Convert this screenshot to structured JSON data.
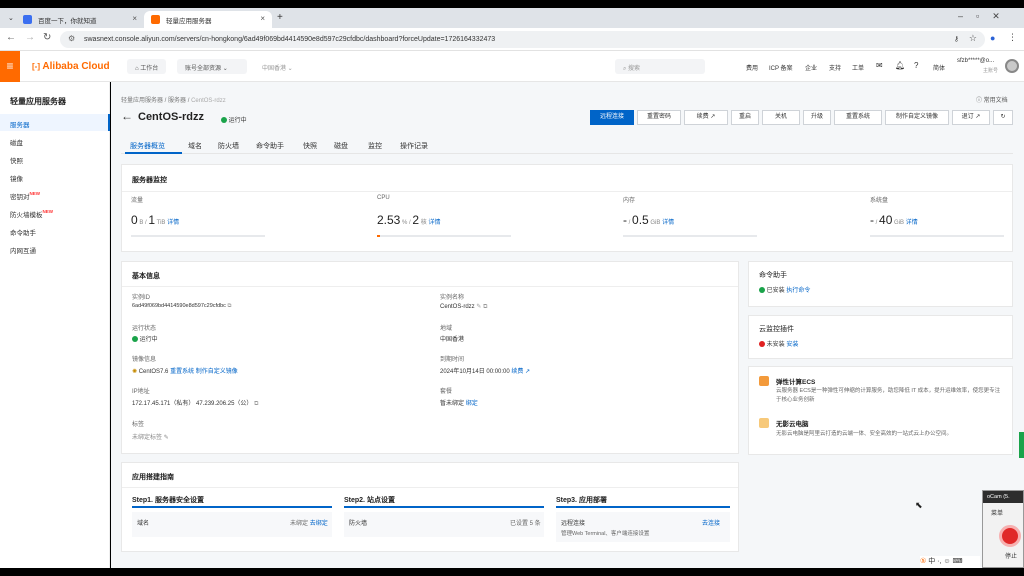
{
  "browser": {
    "tabs": [
      {
        "label": "百度一下，你就知道"
      },
      {
        "label": "轻量应用服务器"
      }
    ],
    "url": "swasnext.console.aliyun.com/servers/cn-hongkong/6ad49f069bd4414590e8d597c29cfdbc/dashboard?forceUpdate=1726164332473"
  },
  "header": {
    "brand": "Alibaba Cloud",
    "workbench": "工作台",
    "resources": "账号全部资源",
    "region": "中国香港",
    "search_placeholder": "搜索",
    "links": [
      "费用",
      "ICP 备案",
      "企业",
      "支持",
      "工单"
    ],
    "lang": "简体",
    "account": "sfzb*****@o...",
    "account_role": "主账号"
  },
  "sidebar": {
    "title": "轻量应用服务器",
    "items": [
      {
        "label": "服务器"
      },
      {
        "label": "磁盘"
      },
      {
        "label": "快照"
      },
      {
        "label": "镜像"
      },
      {
        "label": "密钥对",
        "badge": "NEW"
      },
      {
        "label": "防火墙模板",
        "badge": "NEW"
      },
      {
        "label": "命令助手"
      },
      {
        "label": "内网互通"
      }
    ]
  },
  "breadcrumb": [
    "轻量应用服务器",
    "服务器",
    "CentOS-rdzz"
  ],
  "help_doc": "常用文档",
  "server": {
    "name": "CentOS-rdzz",
    "status": "运行中"
  },
  "actions": [
    "远程连接",
    "重置密码",
    "续费",
    "重启",
    "关机",
    "升级",
    "重置系统",
    "制作自定义镜像",
    "退订"
  ],
  "page_tabs": [
    "服务器概览",
    "域名",
    "防火墙",
    "命令助手",
    "快照",
    "磁盘",
    "监控",
    "操作记录"
  ],
  "monitor": {
    "title": "服务器监控",
    "metrics": [
      {
        "label": "流量",
        "used": "0",
        "unit_used": "B",
        "total": "1",
        "unit_total": "TiB",
        "detail": "详情",
        "fraction": 0
      },
      {
        "label": "CPU",
        "used": "2.53",
        "unit_used": "%",
        "total": "2",
        "unit_total": "核",
        "detail": "详情",
        "fraction": 0.0253
      },
      {
        "label": "内存",
        "used": "-",
        "unit_used": "",
        "total": "0.5",
        "unit_total": "GiB",
        "detail": "详情",
        "fraction": 0
      },
      {
        "label": "系统盘",
        "used": "-",
        "unit_used": "",
        "total": "40",
        "unit_total": "GiB",
        "detail": "详情",
        "fraction": 0
      }
    ]
  },
  "basic": {
    "title": "基本信息",
    "instance_id_label": "实例ID",
    "instance_id": "6ad49f069bd4414590e8d597c29cfdbc",
    "instance_name_label": "实例名称",
    "instance_name": "CentOS-rdzz",
    "run_status_label": "运行状态",
    "run_status": "运行中",
    "region_label": "地域",
    "region": "中国香港",
    "image_label": "镜像信息",
    "image": "CentOS7.6",
    "image_reset": "重置系统",
    "image_custom": "制作自定义镜像",
    "expire_label": "到期时间",
    "expire": "2024年10月14日 00:00:00",
    "renew": "续费",
    "ip_label": "IP地址",
    "ip_private": "172.17.45.171（私有）",
    "ip_public": "47.239.206.25（公）",
    "package_label": "套餐",
    "package": "暂未绑定",
    "package_link": "绑定",
    "tag_label": "标签",
    "tag": "未绑定标签"
  },
  "right": {
    "cmd_title": "命令助手",
    "cmd_status": "已安装",
    "cmd_link": "执行命令",
    "monitor_title": "云监控插件",
    "monitor_status": "未安装",
    "monitor_link": "安装",
    "ecs_title": "弹性计算ECS",
    "ecs_desc": "云服务器 ECS是一种弹性可伸缩的计算服务，助您降低 IT 成本，提升运维效率，使您更专注于核心业务创新",
    "wuying_title": "无影云电脑",
    "wuying_desc": "无影云电脑是阿里云打造的云端一体、安全高效的一站式云上办公空间。"
  },
  "guide": {
    "title": "应用搭建指南",
    "steps": [
      {
        "title": "Step1. 服务器安全设置",
        "item": "域名",
        "status": "未绑定",
        "link": "去绑定"
      },
      {
        "title": "Step2. 站点设置",
        "item": "防火墙",
        "status": "已设置 5 条",
        "link": ""
      },
      {
        "title": "Step3. 应用部署",
        "item": "远程连接",
        "sub": "管理Web Terminal、客户端连接设置",
        "link": "去连接"
      }
    ]
  },
  "overlay": {
    "title": "oCam (5.",
    "menu": "菜单",
    "stop": "停止"
  }
}
